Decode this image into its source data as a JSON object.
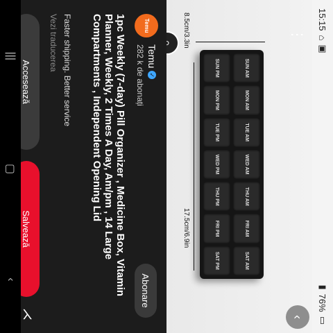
{
  "status_bar": {
    "time": "15:15",
    "battery": "76%"
  },
  "image": {
    "length_label": "17.5cm/6.9in",
    "width_label": "8.5cm/3.3in",
    "organizer_days": [
      "SUN",
      "MON",
      "TUE",
      "WED",
      "THU",
      "FRI",
      "SAT"
    ],
    "slots": [
      "AM",
      "PM"
    ]
  },
  "channel": {
    "avatar_text": "Temu",
    "name": "Temu",
    "subscribers": "282 k de abonați",
    "subscribe_label": "Abonare"
  },
  "video": {
    "title": "1pc Weekly (7-day) Pill Organizer , Medicine Box, Vitamin Planner, Weekly, 2 Times A Day, Am/pm , 14 Large Compartments , Independent Opening Lid",
    "description": "Faster shipping. Better service",
    "translate": "Vezi traducerea"
  },
  "actions": {
    "access_label": "Accesează",
    "save_label": "Salvează"
  },
  "icons": {
    "back": "chevron-left-icon",
    "more": "more-vert-icon",
    "lens": "lens-search-icon",
    "share": "share-icon"
  },
  "colors": {
    "accent_red": "#e8102c",
    "temu_orange": "#f26b1d"
  }
}
